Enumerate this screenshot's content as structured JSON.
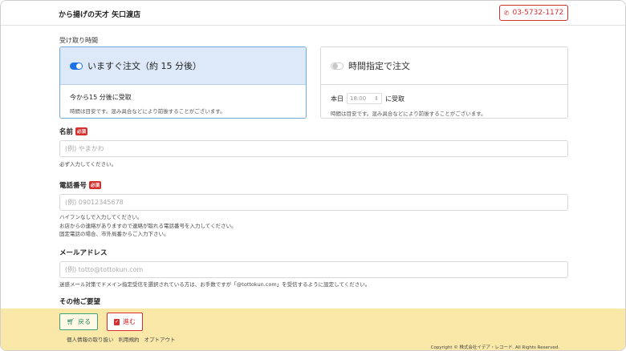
{
  "header": {
    "shop_name": "から揚げの天才 矢口渡店",
    "phone": "03-5732-1172",
    "phone_icon": "phone-icon"
  },
  "pickup": {
    "section_label": "受け取り時間",
    "asap": {
      "title": "いますぐ注文（約 15 分後）",
      "main": "今から15 分後に受取",
      "note": "時間は目安です。混み具合などにより前後することがございます。"
    },
    "scheduled": {
      "title": "時間指定で注文",
      "day": "本日",
      "time_value": "18:00",
      "suffix": "に受取",
      "note": "時間は目安です。混み具合などにより前後することがございます。"
    }
  },
  "form": {
    "required_badge": "必須",
    "name": {
      "label": "名前",
      "placeholder": "(例) やまかわ",
      "hint": "必ず入力してください。"
    },
    "phone": {
      "label": "電話番号",
      "placeholder": "(例) 09012345678",
      "hint1": "ハイフンなしで入力してください。",
      "hint2": "お店からの連絡がありますので連絡が取れる電話番号を入力してください。",
      "hint3": "固定電話の場合、市外局番からご入力下さい。"
    },
    "email": {
      "label": "メールアドレス",
      "placeholder": "(例) totto@tottokun.com",
      "hint": "迷惑メール対策でドメイン指定受信を選択されている方は、お手数ですが「@tottokun.com」を受信するように設定してください。"
    },
    "other": {
      "label": "その他ご要望"
    }
  },
  "footer": {
    "back_label": "戻る",
    "next_label": "進む",
    "links": [
      "個人情報の取り扱い",
      "利用規約",
      "オプトアウト"
    ],
    "copyright": "Copyright © 株式会社イデア・レコード. All Rights Reserved."
  }
}
